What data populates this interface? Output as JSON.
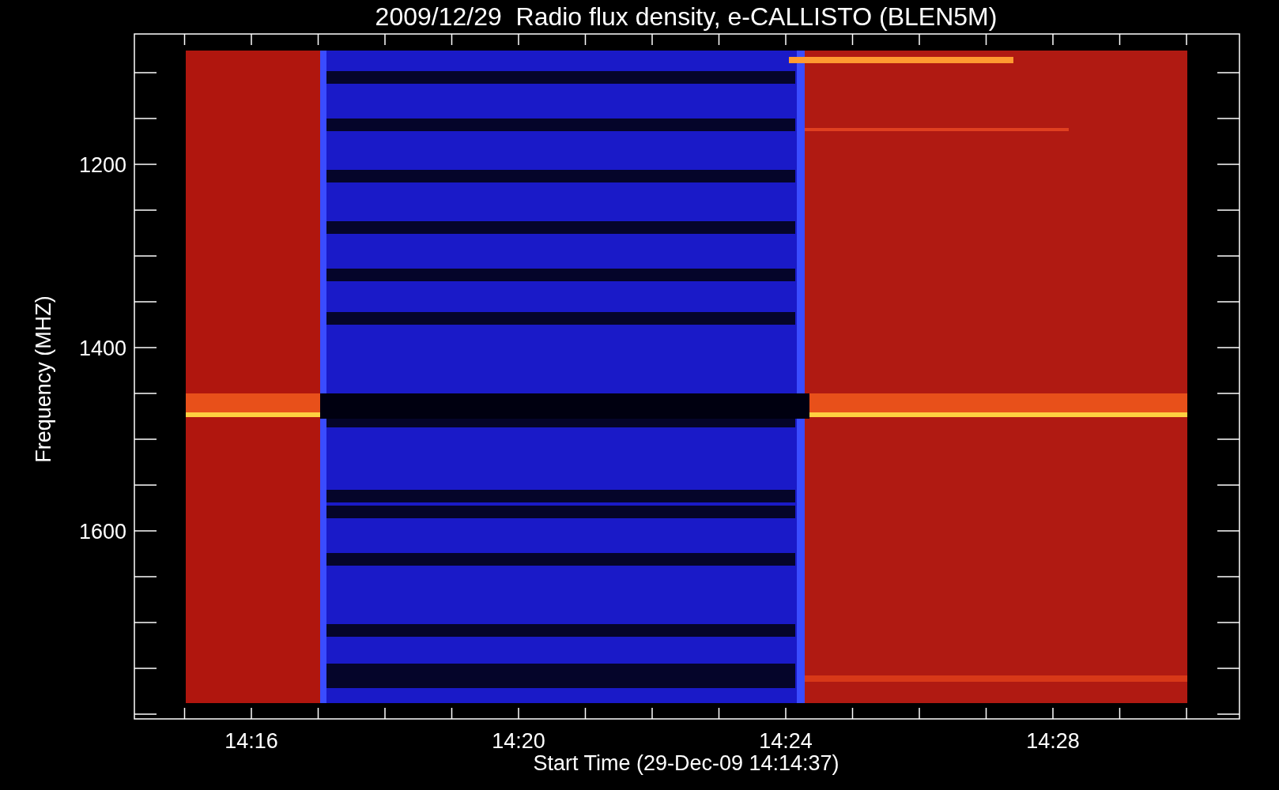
{
  "plot": {
    "title": "2009/12/29  Radio flux density, e-CALLISTO (BLEN5M)",
    "y_axis": {
      "label": "Frequency (MHZ)",
      "ticks": [
        "1200",
        "1400",
        "1600"
      ]
    },
    "x_axis": {
      "label": "Start Time (29-Dec-09 14:14:37)",
      "ticks": [
        "14:16",
        "14:20",
        "14:24",
        "14:28"
      ]
    }
  }
}
